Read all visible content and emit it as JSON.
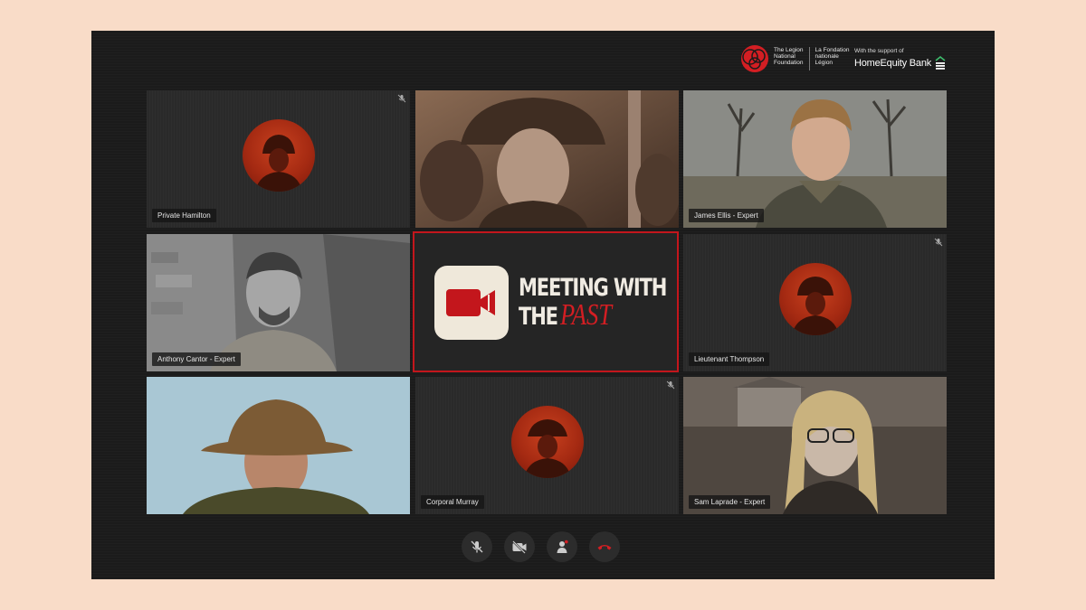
{
  "branding": {
    "legion_en": "The Legion\nNational\nFoundation",
    "legion_fr": "La Fondation\nnationale\nLégion",
    "support_text": "With the support of",
    "bank_name": "HomeEquity Bank"
  },
  "meeting_logo": {
    "line1": "MEETING WITH",
    "line2_plain": "THE",
    "line2_accent": "PAST",
    "accent_color": "#d31e23"
  },
  "participants": [
    {
      "name": "Private Hamilton",
      "muted": true,
      "video": false
    },
    {
      "name": "",
      "muted": false,
      "video": true
    },
    {
      "name": "James Ellis - Expert",
      "muted": false,
      "video": true
    },
    {
      "name": "Anthony Cantor - Expert",
      "muted": false,
      "video": true
    },
    {
      "name": "Lieutenant Thompson",
      "muted": true,
      "video": false
    },
    {
      "name": "",
      "muted": false,
      "video": true
    },
    {
      "name": "Corporal Murray",
      "muted": true,
      "video": false
    },
    {
      "name": "Sam Laprade - Expert",
      "muted": false,
      "video": true
    }
  ],
  "controls": [
    {
      "icon": "mic-off-icon"
    },
    {
      "icon": "camera-off-icon"
    },
    {
      "icon": "participants-icon"
    },
    {
      "icon": "end-call-icon",
      "color": "#d31e23"
    }
  ]
}
